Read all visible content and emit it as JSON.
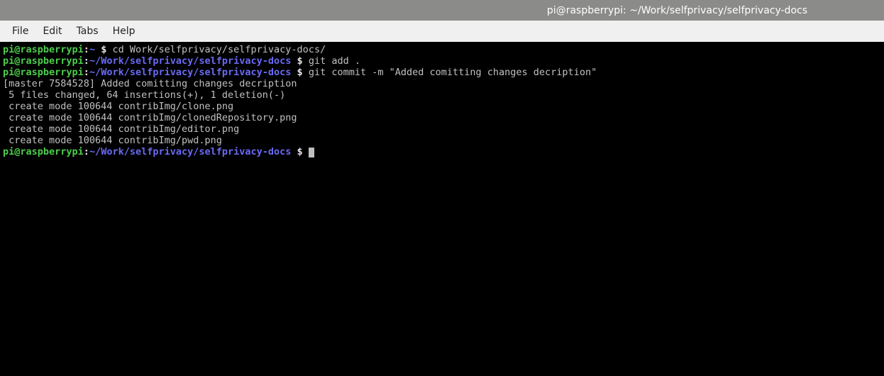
{
  "titlebar": {
    "text": "pi@raspberrypi: ~/Work/selfprivacy/selfprivacy-docs"
  },
  "menubar": {
    "items": [
      "File",
      "Edit",
      "Tabs",
      "Help"
    ]
  },
  "terminal": {
    "lines": [
      {
        "user": "pi@raspberrypi",
        "sep": ":",
        "path": "~",
        "prompt": " $ ",
        "cmd": "cd Work/selfprivacy/selfprivacy-docs/"
      },
      {
        "user": "pi@raspberrypi",
        "sep": ":",
        "path": "~/Work/selfprivacy/selfprivacy-docs",
        "prompt": " $ ",
        "cmd": "git add ."
      },
      {
        "user": "pi@raspberrypi",
        "sep": ":",
        "path": "~/Work/selfprivacy/selfprivacy-docs",
        "prompt": " $ ",
        "cmd": "git commit -m \"Added comitting changes decription\""
      },
      {
        "out": "[master 7584528] Added comitting changes decription"
      },
      {
        "out": " 5 files changed, 64 insertions(+), 1 deletion(-)"
      },
      {
        "out": " create mode 100644 contribImg/clone.png"
      },
      {
        "out": " create mode 100644 contribImg/clonedRepository.png"
      },
      {
        "out": " create mode 100644 contribImg/editor.png"
      },
      {
        "out": " create mode 100644 contribImg/pwd.png"
      },
      {
        "user": "pi@raspberrypi",
        "sep": ":",
        "path": "~/Work/selfprivacy/selfprivacy-docs",
        "prompt": " $ ",
        "cmd": "",
        "cursor": true
      }
    ]
  }
}
